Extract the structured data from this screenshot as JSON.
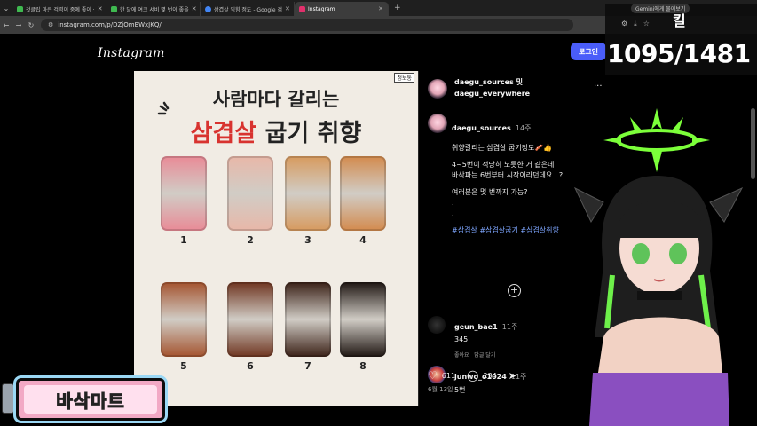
{
  "tabs": [
    {
      "label": "것클립 마큰 걱력이 중예 좋이 ·",
      "color": "#3fb950"
    },
    {
      "label": "한 달에 여크 서비 몇 번이 좋을",
      "color": "#3fb950"
    },
    {
      "label": "삼겹살 익힘 정도 - Google 검",
      "color": "#4285f4"
    },
    {
      "label": "Instagram",
      "color": "#e1306c"
    }
  ],
  "address": {
    "url": "instagram.com/p/DZjOmBWxJKQ/"
  },
  "header": {
    "logo": "Instagram",
    "login": "로그인"
  },
  "post": {
    "badge": "정보통",
    "headline1": "사람마다 갈리는",
    "headline2_red": "삼겹살",
    "headline2_rest": " 굽기 취향",
    "meat_levels": [
      {
        "n": "1",
        "color": "#e98a96"
      },
      {
        "n": "2",
        "color": "#e8b7a8"
      },
      {
        "n": "3",
        "color": "#d79a5e"
      },
      {
        "n": "4",
        "color": "#d38a4d"
      },
      {
        "n": "5",
        "color": "#a4532e"
      },
      {
        "n": "6",
        "color": "#6f3520"
      },
      {
        "n": "7",
        "color": "#3b2117"
      },
      {
        "n": "8",
        "color": "#1f1612"
      }
    ]
  },
  "panel": {
    "author_line1": "daegu_sources 및",
    "author_line2": "daegu_everywhere",
    "more": "···",
    "caption_user": "daegu_sources",
    "caption_time": "14주",
    "caption_lines": [
      "취향갈리는 삼겹살 굽기정도🥓👍",
      "",
      "4~5번이 적당히 노릇한 거 같은데",
      "바삭파는 6번부터 시작이라던데요...?",
      "",
      "여러분은 몇 번까지 가능?",
      ".",
      ".",
      ""
    ],
    "hashtags": "#삼겹살 #삼겹살굽기 #삼겹살취향",
    "comments": [
      {
        "user": "geun_bae1",
        "time": "11주",
        "text": "345",
        "likes": "좋아요",
        "reply": "답글 달기"
      },
      {
        "user": "junwo_o1024",
        "time": "11주",
        "text": "5번"
      }
    ],
    "like_count": "611",
    "comment_count": "234",
    "date": "6월 13일"
  },
  "overlay": {
    "gemini": "Gemini에게 물어보기",
    "kill_label": "킬",
    "kill_count": "1095/1481",
    "banner_text": "바삭마트"
  }
}
